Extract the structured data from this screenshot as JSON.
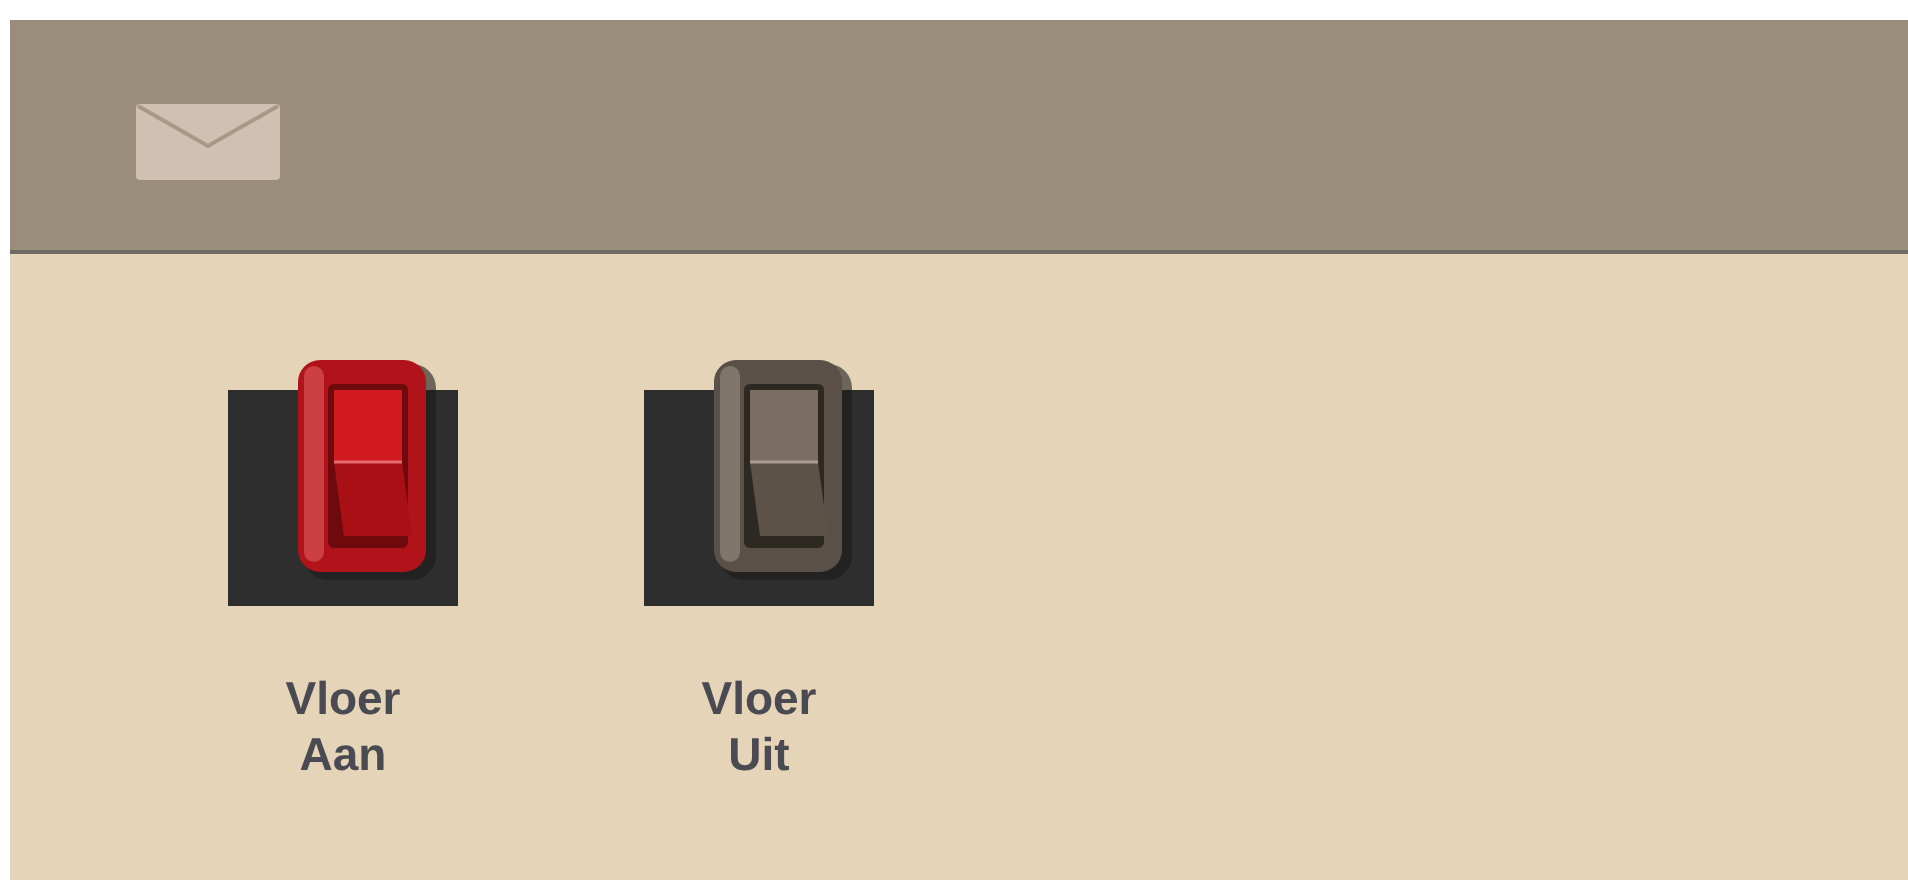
{
  "switches": [
    {
      "label": "Vloer Aan",
      "on": true
    },
    {
      "label": "Vloer Uit",
      "on": false
    }
  ]
}
